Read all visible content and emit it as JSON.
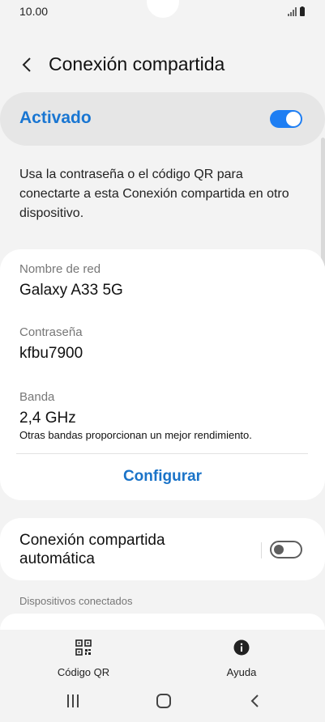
{
  "status_bar": {
    "time": "10.00"
  },
  "header": {
    "title": "Conexión compartida"
  },
  "master_switch": {
    "label": "Activado",
    "on": true,
    "accent": "#1e7ef3"
  },
  "description": "Usa la contraseña o el código QR para conectarte a esta Conexión compartida en otro dispositivo.",
  "network": {
    "name_label": "Nombre de red",
    "name_value": "Galaxy A33 5G",
    "password_label": "Contraseña",
    "password_value": "kfbu7900",
    "band_label": "Banda",
    "band_value": "2,4 GHz",
    "band_note": "Otras bandas proporcionan un mejor rendimiento.",
    "configure_label": "Configurar"
  },
  "auto_hotspot": {
    "label": "Conexión compartida automática",
    "on": false
  },
  "devices": {
    "title": "Dispositivos conectados"
  },
  "bottom_actions": {
    "qr_label": "Código QR",
    "help_label": "Ayuda"
  }
}
